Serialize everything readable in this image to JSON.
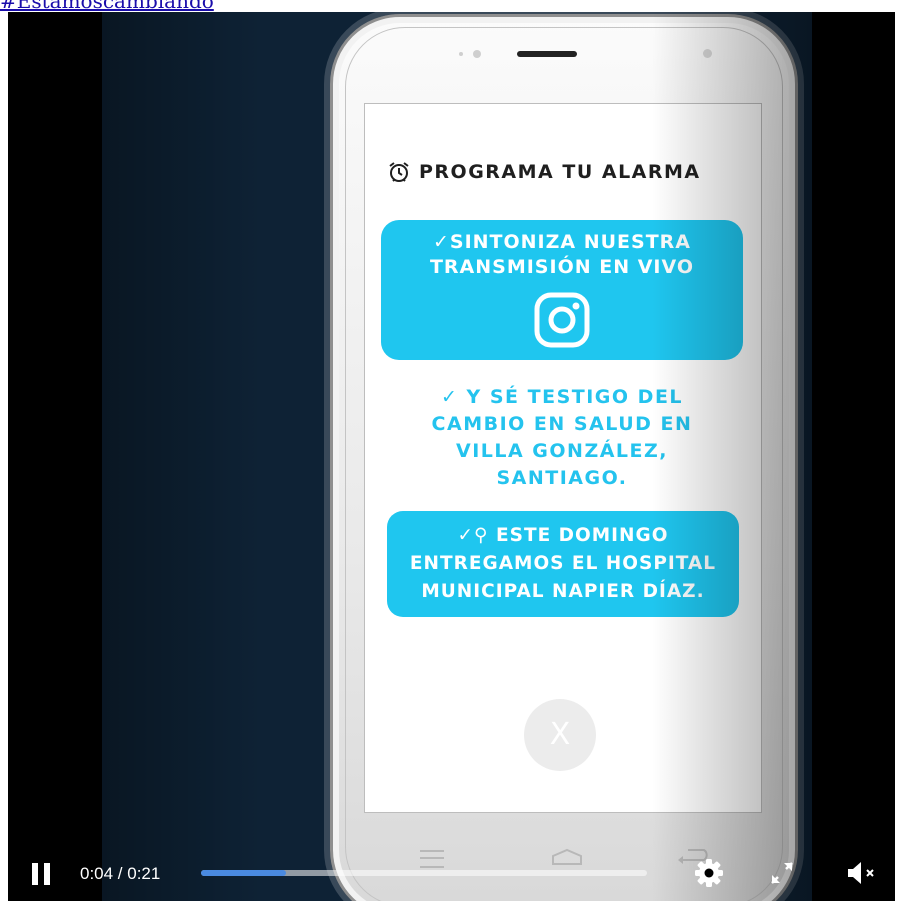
{
  "top_link": {
    "text": "#Estamoscambiando"
  },
  "phone_screen": {
    "alarm_title": "PROGRAMA TU ALARMA",
    "box1_text": "✓SINTONIZA NUESTRA\nTRANSMISIÓN EN VIVO",
    "middle_text": "✓ Y SÉ TESTIGO DEL\nCAMBIO EN SALUD EN\nVILLA GONZÁLEZ,\nSANTIAGO.",
    "box2_text": "✓⚲ ESTE DOMINGO\nENTREGAMOS EL HOSPITAL\nMUNICIPAL NAPIER DÍAZ.",
    "close_label": "X"
  },
  "player": {
    "timecode": "0:04 / 0:21",
    "progress_fraction": 0.19,
    "accent_color": "#4a8ae0",
    "icons": [
      "pause-icon",
      "gear-icon",
      "fullscreen-icon",
      "volume-muted-icon"
    ]
  },
  "colors": {
    "brand_cyan": "#1fc6ef",
    "background_navy": "#0e2235"
  }
}
